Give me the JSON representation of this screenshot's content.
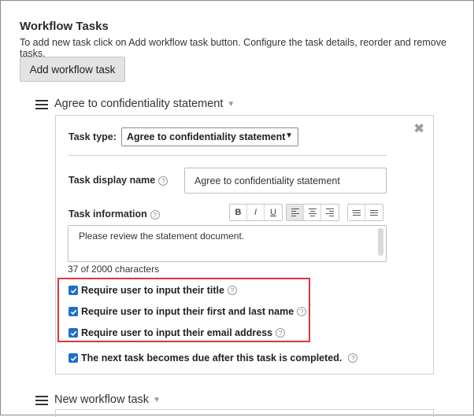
{
  "section": {
    "title": "Workflow Tasks",
    "description": "To add new task click on Add workflow task button. Configure the task details, reorder and remove tasks.",
    "add_button": "Add workflow task"
  },
  "tasks": [
    {
      "header_title": "Agree to confidentiality statement",
      "task_type_label": "Task type:",
      "task_type_value": "Agree to confidentiality statement",
      "display_name_label": "Task display name",
      "display_name_value": "Agree to confidentiality statement",
      "info_label": "Task information",
      "info_value": "Please review the statement document.",
      "char_count": "37 of 2000 characters",
      "checkboxes": [
        {
          "label": "Require user to input their title",
          "checked": true
        },
        {
          "label": "Require user to input their first and last name",
          "checked": true
        },
        {
          "label": "Require user to input their email address",
          "checked": true
        },
        {
          "label": "The next task becomes due after this task is completed.",
          "checked": true
        }
      ]
    },
    {
      "header_title": "New workflow task"
    }
  ],
  "toolbar": {
    "bold": "B",
    "italic": "I",
    "underline": "U"
  },
  "icons": {
    "help": "?",
    "close": "✖",
    "checkmark": "✓"
  },
  "colors": {
    "checkbox": "#1f6fc9",
    "highlight_border": "#d9363e"
  }
}
